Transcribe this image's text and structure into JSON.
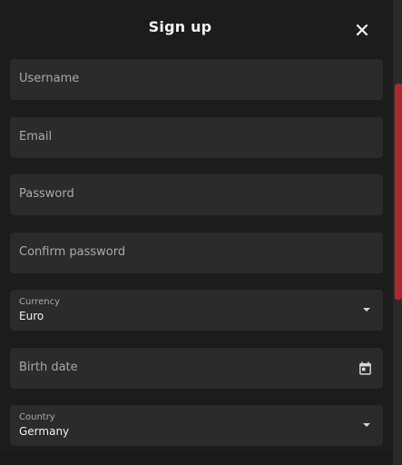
{
  "modal": {
    "title": "Sign up"
  },
  "form": {
    "username": {
      "placeholder": "Username"
    },
    "email": {
      "placeholder": "Email"
    },
    "password": {
      "placeholder": "Password"
    },
    "confirm_password": {
      "placeholder": "Confirm password"
    },
    "currency": {
      "label": "Currency",
      "value": "Euro"
    },
    "birth_date": {
      "placeholder": "Birth date"
    },
    "country": {
      "label": "Country",
      "value": "Germany"
    }
  },
  "icons": {
    "close": "close-icon",
    "calendar": "calendar-icon",
    "dropdown": "chevron-down-icon"
  },
  "colors": {
    "accent": "#b3262f",
    "modal_bg": "#1c1c1c",
    "field_bg": "#2b2b2b"
  }
}
